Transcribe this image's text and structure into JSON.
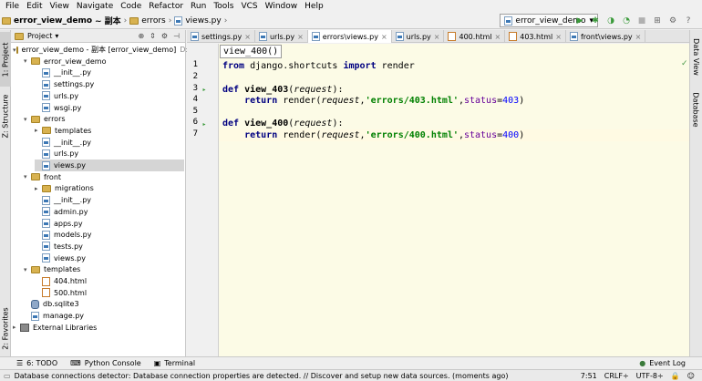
{
  "menu": [
    "File",
    "Edit",
    "View",
    "Navigate",
    "Code",
    "Refactor",
    "Run",
    "Tools",
    "VCS",
    "Window",
    "Help"
  ],
  "breadcrumb": {
    "project": "error_view_demo",
    "suffix": "~ 副本",
    "folder": "errors",
    "file": "views.py"
  },
  "run_config": "error_view_demo",
  "left_tabs": {
    "project": "1: Project",
    "structure": "Z: Structure",
    "favorites": "2: Favorites"
  },
  "right_tabs": {
    "dataview": "Data View",
    "database": "Database"
  },
  "project_panel": {
    "title": "Project",
    "tree": [
      {
        "label": "error_view_demo - 副本 [error_view_demo]",
        "extra": "D:",
        "icon": "folder",
        "depth": 0,
        "open": true,
        "bold": false
      },
      {
        "label": "error_view_demo",
        "icon": "folder",
        "depth": 1,
        "open": true
      },
      {
        "label": "__init__.py",
        "icon": "py",
        "depth": 2
      },
      {
        "label": "settings.py",
        "icon": "py",
        "depth": 2
      },
      {
        "label": "urls.py",
        "icon": "py",
        "depth": 2
      },
      {
        "label": "wsgi.py",
        "icon": "py",
        "depth": 2
      },
      {
        "label": "errors",
        "icon": "folder",
        "depth": 1,
        "open": true
      },
      {
        "label": "templates",
        "icon": "folder",
        "depth": 2,
        "open": false
      },
      {
        "label": "__init__.py",
        "icon": "py",
        "depth": 2
      },
      {
        "label": "urls.py",
        "icon": "py",
        "depth": 2
      },
      {
        "label": "views.py",
        "icon": "py",
        "depth": 2,
        "selected": true
      },
      {
        "label": "front",
        "icon": "folder",
        "depth": 1,
        "open": true
      },
      {
        "label": "migrations",
        "icon": "folder",
        "depth": 2,
        "open": false
      },
      {
        "label": "__init__.py",
        "icon": "py",
        "depth": 2
      },
      {
        "label": "admin.py",
        "icon": "py",
        "depth": 2
      },
      {
        "label": "apps.py",
        "icon": "py",
        "depth": 2
      },
      {
        "label": "models.py",
        "icon": "py",
        "depth": 2
      },
      {
        "label": "tests.py",
        "icon": "py",
        "depth": 2
      },
      {
        "label": "views.py",
        "icon": "py",
        "depth": 2
      },
      {
        "label": "templates",
        "icon": "folder",
        "depth": 1,
        "open": true
      },
      {
        "label": "404.html",
        "icon": "html",
        "depth": 2
      },
      {
        "label": "500.html",
        "icon": "html",
        "depth": 2
      },
      {
        "label": "db.sqlite3",
        "icon": "db",
        "depth": 1
      },
      {
        "label": "manage.py",
        "icon": "py",
        "depth": 1
      },
      {
        "label": "External Libraries",
        "icon": "lib",
        "depth": 0,
        "open": false
      }
    ]
  },
  "tabs": [
    {
      "label": "settings.py",
      "icon": "py"
    },
    {
      "label": "urls.py",
      "icon": "py"
    },
    {
      "label": "errors\\views.py",
      "icon": "py",
      "active": true
    },
    {
      "label": "urls.py",
      "icon": "py"
    },
    {
      "label": "400.html",
      "icon": "html"
    },
    {
      "label": "403.html",
      "icon": "html"
    },
    {
      "label": "front\\views.py",
      "icon": "py"
    }
  ],
  "editor": {
    "popup": "view_400()",
    "line_numbers": [
      "1",
      "2",
      "3",
      "4",
      "5",
      "6",
      "7"
    ],
    "lines": [
      [
        {
          "t": "from",
          "c": "kw"
        },
        {
          "t": " django.shortcuts ",
          "c": ""
        },
        {
          "t": "import",
          "c": "kw"
        },
        {
          "t": " render",
          "c": ""
        }
      ],
      [],
      [
        {
          "t": "def",
          "c": "kw"
        },
        {
          "t": " ",
          "c": ""
        },
        {
          "t": "view_403",
          "c": "fn"
        },
        {
          "t": "(",
          "c": ""
        },
        {
          "t": "request",
          "c": "prm"
        },
        {
          "t": "):",
          "c": ""
        }
      ],
      [
        {
          "t": "    ",
          "c": ""
        },
        {
          "t": "return",
          "c": "kw"
        },
        {
          "t": " render(",
          "c": ""
        },
        {
          "t": "request",
          "c": "prm"
        },
        {
          "t": ",",
          "c": ""
        },
        {
          "t": "'errors/403.html'",
          "c": "str"
        },
        {
          "t": ",",
          "c": ""
        },
        {
          "t": "status",
          "c": "kwarg"
        },
        {
          "t": "=",
          "c": ""
        },
        {
          "t": "403",
          "c": "num"
        },
        {
          "t": ")",
          "c": ""
        }
      ],
      [],
      [
        {
          "t": "def",
          "c": "kw"
        },
        {
          "t": " ",
          "c": ""
        },
        {
          "t": "view_400",
          "c": "fn"
        },
        {
          "t": "(",
          "c": ""
        },
        {
          "t": "request",
          "c": "prm"
        },
        {
          "t": "):",
          "c": ""
        }
      ],
      [
        {
          "t": "    ",
          "c": ""
        },
        {
          "t": "return",
          "c": "kw"
        },
        {
          "t": " render(",
          "c": ""
        },
        {
          "t": "request",
          "c": "prm"
        },
        {
          "t": ",",
          "c": ""
        },
        {
          "t": "'errors/400.html'",
          "c": "str"
        },
        {
          "t": ",",
          "c": ""
        },
        {
          "t": "status",
          "c": "kwarg"
        },
        {
          "t": "=",
          "c": ""
        },
        {
          "t": "400",
          "c": "num"
        },
        {
          "t": ")",
          "c": ""
        }
      ]
    ]
  },
  "bottom_tools": [
    {
      "label": "6: TODO",
      "icon": "todo-icon"
    },
    {
      "label": "Python Console",
      "icon": "python-console-icon"
    },
    {
      "label": "Terminal",
      "icon": "terminal-icon"
    }
  ],
  "event_log": "Event Log",
  "status": {
    "message": "Database connections detector: Database connection properties are detected. // Discover and setup new data sources. (moments ago)",
    "position": "7:51",
    "line_sep": "CRLF÷",
    "encoding": "UTF-8÷"
  }
}
